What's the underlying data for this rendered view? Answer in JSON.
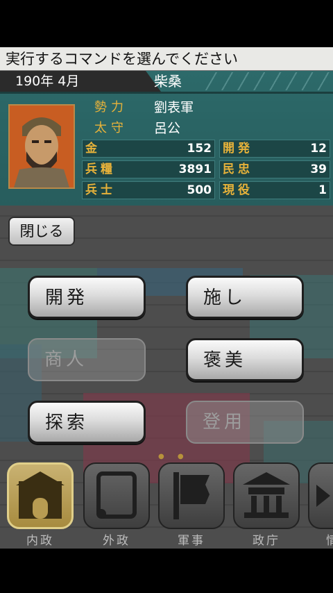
{
  "prompt": "実行するコマンドを選んでください",
  "date": "190年  4月",
  "city": "柴桑",
  "faction": {
    "label": "勢力",
    "value": "劉表軍"
  },
  "governor": {
    "label": "太守",
    "value": "呂公"
  },
  "stats": [
    {
      "label": "金",
      "value": "152"
    },
    {
      "label": "開発",
      "value": "12"
    },
    {
      "label": "兵糧",
      "value": "3891"
    },
    {
      "label": "民忠",
      "value": "39"
    },
    {
      "label": "兵士",
      "value": "500"
    },
    {
      "label": "現役",
      "value": "1"
    }
  ],
  "close_label": "閉じる",
  "commands": [
    {
      "label": "開発",
      "enabled": true
    },
    {
      "label": "施し",
      "enabled": true
    },
    {
      "label": "商人",
      "enabled": false
    },
    {
      "label": "褒美",
      "enabled": true
    },
    {
      "label": "探索",
      "enabled": true
    },
    {
      "label": "登用",
      "enabled": false
    }
  ],
  "nav": [
    {
      "label": "内政",
      "icon": "castle-gate-icon",
      "active": true
    },
    {
      "label": "外政",
      "icon": "scroll-icon",
      "active": false
    },
    {
      "label": "軍事",
      "icon": "banner-flag-icon",
      "active": false
    },
    {
      "label": "政庁",
      "icon": "government-hall-icon",
      "active": false
    },
    {
      "label": "情",
      "icon": "intel-icon",
      "active": false
    }
  ],
  "colors": {
    "panel": "#2a6464",
    "label_gold": "#e7b23a",
    "active_tab": "#b89c52"
  }
}
